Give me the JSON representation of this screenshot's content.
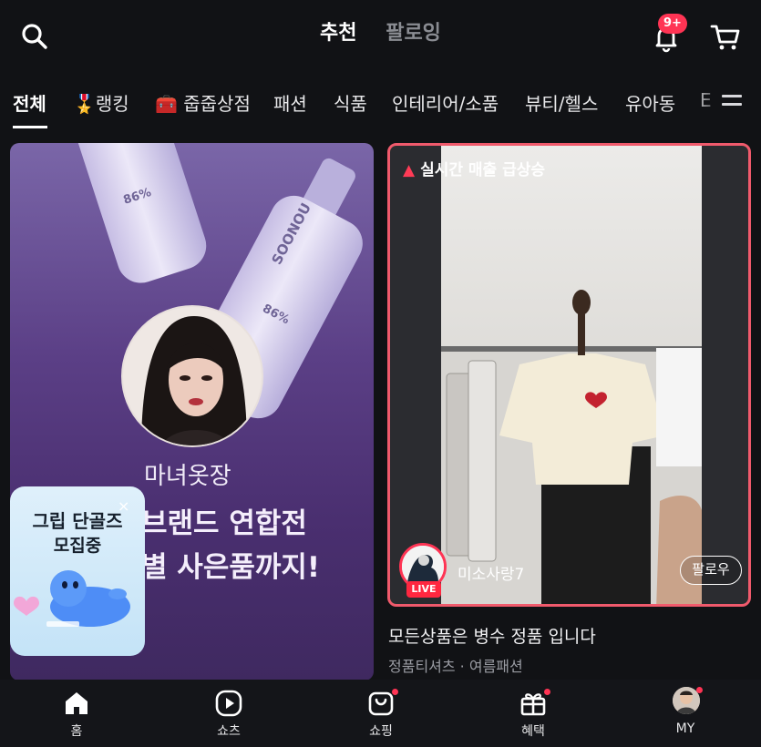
{
  "header": {
    "tabs": [
      {
        "label": "추천",
        "active": true
      },
      {
        "label": "팔로잉",
        "active": false
      }
    ],
    "notification_badge": "9+",
    "icons": {
      "search": "search-icon",
      "bell": "bell-icon",
      "cart": "cart-icon"
    }
  },
  "categories": [
    {
      "label": "전체",
      "active": true
    },
    {
      "label": "🎖️랭킹"
    },
    {
      "label": "🧰 줍줍상점"
    },
    {
      "label": "패션"
    },
    {
      "label": "식품"
    },
    {
      "label": "인테리어/소품"
    },
    {
      "label": "뷰티/헬스"
    },
    {
      "label": "유아동"
    },
    {
      "label": "E"
    }
  ],
  "left_card": {
    "host_name": "마녀옷장",
    "promo_line1": "브랜드 연합전",
    "promo_line2": "별 사은품까지!",
    "bottle_text1": "86%",
    "bottle_text2": "SOONOU",
    "bottle_text3": "86%"
  },
  "recruit_popup": {
    "line1": "그립 단골즈",
    "line2": "모집중",
    "close": "×"
  },
  "right_card": {
    "trend_label": "실시간 매출 급상승",
    "seller_name": "미소사랑7",
    "live_tag": "LIVE",
    "follow_label": "팔로우",
    "product_title": "모든상품은 병수 정품 입니다",
    "product_subtitle": "정품티셔츠 · 여름패션"
  },
  "bottom_nav": [
    {
      "label": "홈",
      "icon": "home-icon"
    },
    {
      "label": "쇼츠",
      "icon": "play-icon"
    },
    {
      "label": "쇼핑",
      "icon": "shopping-bag-icon"
    },
    {
      "label": "혜택",
      "icon": "gift-icon"
    },
    {
      "label": "MY",
      "icon": "avatar"
    }
  ],
  "colors": {
    "background": "#111215",
    "accent": "#ff3454",
    "live_border": "#f05a6c"
  }
}
